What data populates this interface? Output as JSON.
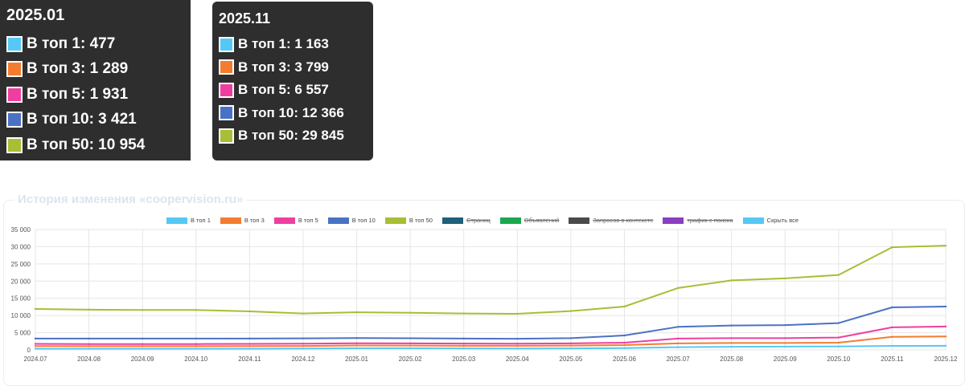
{
  "tooltips": [
    {
      "date": "2025.01",
      "rows": [
        {
          "label": "В топ 1",
          "value": "477",
          "color": "#56c8f5"
        },
        {
          "label": "В топ 3",
          "value": "1 289",
          "color": "#f47c30"
        },
        {
          "label": "В топ 5",
          "value": "1 931",
          "color": "#ee3fa0"
        },
        {
          "label": "В топ 10",
          "value": "3 421",
          "color": "#4a72c4"
        },
        {
          "label": "В топ 50",
          "value": "10 954",
          "color": "#a8be35"
        }
      ]
    },
    {
      "date": "2025.11",
      "rows": [
        {
          "label": "В топ 1",
          "value": "1 163",
          "color": "#56c8f5"
        },
        {
          "label": "В топ 3",
          "value": "3 799",
          "color": "#f47c30"
        },
        {
          "label": "В топ 5",
          "value": "6 557",
          "color": "#ee3fa0"
        },
        {
          "label": "В топ 10",
          "value": "12 366",
          "color": "#4a72c4"
        },
        {
          "label": "В топ 50",
          "value": "29 845",
          "color": "#a8be35"
        }
      ]
    }
  ],
  "card": {
    "title": "История изменения «coopervision.ru»"
  },
  "legend": [
    {
      "label": "В топ 1",
      "color": "#56c8f5",
      "hidden": false
    },
    {
      "label": "В топ 3",
      "color": "#f47c30",
      "hidden": false
    },
    {
      "label": "В топ 5",
      "color": "#ee3fa0",
      "hidden": false
    },
    {
      "label": "В топ 10",
      "color": "#4a72c4",
      "hidden": false
    },
    {
      "label": "В топ 50",
      "color": "#a8be35",
      "hidden": false
    },
    {
      "label": "Страниц",
      "color": "#1e5f7a",
      "hidden": true
    },
    {
      "label": "Объявлений",
      "color": "#1aa84f",
      "hidden": true
    },
    {
      "label": "Запросов в контексте",
      "color": "#4a4a4a",
      "hidden": true
    },
    {
      "label": "трафик с поиска",
      "color": "#8a3fc0",
      "hidden": true
    },
    {
      "label": "Скрыть все",
      "color": "#56c8f5",
      "hidden": false
    }
  ],
  "chart_data": {
    "type": "line",
    "x": [
      "2024.07",
      "2024.08",
      "2024.09",
      "2024.10",
      "2024.11",
      "2024.12",
      "2025.01",
      "2025.02",
      "2025.03",
      "2025.04",
      "2025.05",
      "2025.06",
      "2025.07",
      "2025.08",
      "2025.09",
      "2025.10",
      "2025.11",
      "2025.12"
    ],
    "y_ticks": [
      "0",
      "5 000",
      "10 000",
      "15 000",
      "20 000",
      "25 000",
      "30 000",
      "35 000"
    ],
    "ylim": [
      0,
      35000
    ],
    "grid": true,
    "legend_position": "top",
    "series": [
      {
        "name": "В топ 1",
        "color": "#56c8f5",
        "values": [
          350,
          340,
          340,
          340,
          360,
          400,
          477,
          460,
          440,
          430,
          450,
          520,
          800,
          900,
          950,
          1000,
          1163,
          1200
        ]
      },
      {
        "name": "В топ 3",
        "color": "#f47c30",
        "values": [
          1100,
          1080,
          1080,
          1080,
          1100,
          1150,
          1289,
          1250,
          1200,
          1180,
          1250,
          1400,
          1900,
          2000,
          2000,
          2100,
          3799,
          3900
        ]
      },
      {
        "name": "В топ 5",
        "color": "#ee3fa0",
        "values": [
          1750,
          1700,
          1700,
          1700,
          1750,
          1800,
          1931,
          1900,
          1850,
          1820,
          1900,
          2100,
          3300,
          3400,
          3400,
          3600,
          6557,
          6800
        ]
      },
      {
        "name": "В топ 10",
        "color": "#4a72c4",
        "values": [
          3300,
          3280,
          3280,
          3290,
          3300,
          3350,
          3421,
          3380,
          3300,
          3250,
          3400,
          4200,
          6700,
          7100,
          7200,
          7800,
          12366,
          12600
        ]
      },
      {
        "name": "В топ 50",
        "color": "#a8be35",
        "values": [
          11900,
          11700,
          11600,
          11600,
          11200,
          10600,
          10954,
          10800,
          10600,
          10500,
          11300,
          12600,
          18000,
          20200,
          20800,
          21800,
          29845,
          30300
        ]
      }
    ]
  }
}
